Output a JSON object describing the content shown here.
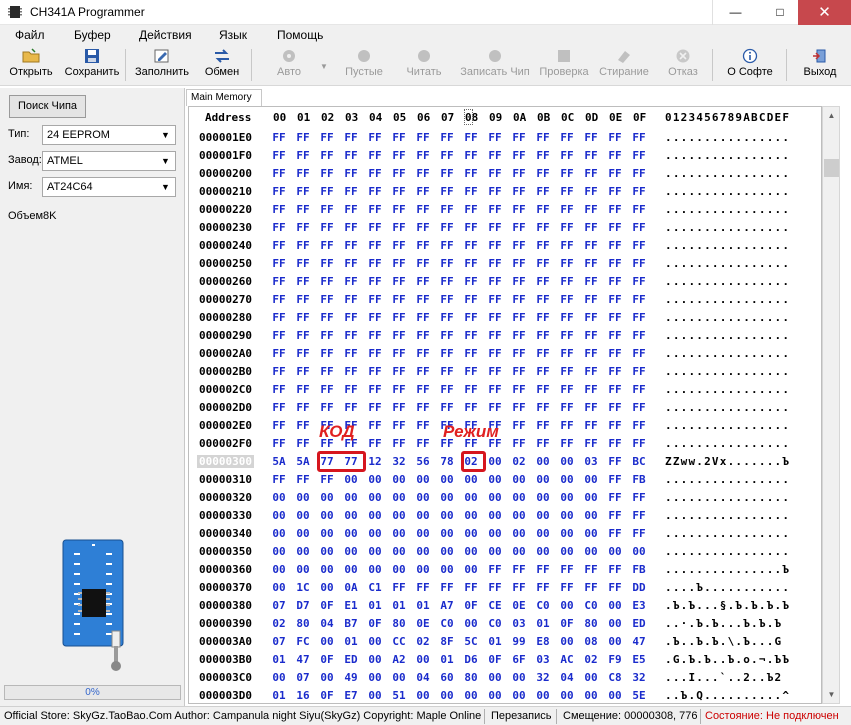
{
  "window": {
    "title": "CH341A Programmer",
    "minimize": "—",
    "maximize": "□",
    "close": "✕"
  },
  "menu": [
    "Файл",
    "Буфер",
    "Действия",
    "Язык",
    "Помощь"
  ],
  "toolbar": {
    "open": "Открыть",
    "save": "Сохранить",
    "fill": "Заполнить",
    "swap": "Обмен",
    "auto": "Авто",
    "blank": "Пустые",
    "read": "Читать",
    "write": "Записать Чип",
    "verify": "Проверка",
    "erase": "Стирание",
    "cancel": "Отказ",
    "about": "О Софте",
    "exit": "Выход"
  },
  "left": {
    "find_chip": "Поиск Чипа",
    "type_label": "Тип:",
    "type_value": "24 EEPROM",
    "vendor_label": "Завод:",
    "vendor_value": "ATMEL",
    "name_label": "Имя:",
    "name_value": "AT24C64",
    "size_label": "Объем8K",
    "progress": "0%"
  },
  "tab": "Main Memory",
  "hex": {
    "address_header": "Address",
    "columns": [
      "00",
      "01",
      "02",
      "03",
      "04",
      "05",
      "06",
      "07",
      "08",
      "09",
      "0A",
      "0B",
      "0C",
      "0D",
      "0E",
      "0F"
    ],
    "ascii_header": "0123456789ABCDEF",
    "rows": [
      {
        "addr": "000001E0",
        "bytes": [
          "FF",
          "FF",
          "FF",
          "FF",
          "FF",
          "FF",
          "FF",
          "FF",
          "FF",
          "FF",
          "FF",
          "FF",
          "FF",
          "FF",
          "FF",
          "FF"
        ],
        "ascii": "................"
      },
      {
        "addr": "000001F0",
        "bytes": [
          "FF",
          "FF",
          "FF",
          "FF",
          "FF",
          "FF",
          "FF",
          "FF",
          "FF",
          "FF",
          "FF",
          "FF",
          "FF",
          "FF",
          "FF",
          "FF"
        ],
        "ascii": "................"
      },
      {
        "addr": "00000200",
        "bytes": [
          "FF",
          "FF",
          "FF",
          "FF",
          "FF",
          "FF",
          "FF",
          "FF",
          "FF",
          "FF",
          "FF",
          "FF",
          "FF",
          "FF",
          "FF",
          "FF"
        ],
        "ascii": "................"
      },
      {
        "addr": "00000210",
        "bytes": [
          "FF",
          "FF",
          "FF",
          "FF",
          "FF",
          "FF",
          "FF",
          "FF",
          "FF",
          "FF",
          "FF",
          "FF",
          "FF",
          "FF",
          "FF",
          "FF"
        ],
        "ascii": "................"
      },
      {
        "addr": "00000220",
        "bytes": [
          "FF",
          "FF",
          "FF",
          "FF",
          "FF",
          "FF",
          "FF",
          "FF",
          "FF",
          "FF",
          "FF",
          "FF",
          "FF",
          "FF",
          "FF",
          "FF"
        ],
        "ascii": "................"
      },
      {
        "addr": "00000230",
        "bytes": [
          "FF",
          "FF",
          "FF",
          "FF",
          "FF",
          "FF",
          "FF",
          "FF",
          "FF",
          "FF",
          "FF",
          "FF",
          "FF",
          "FF",
          "FF",
          "FF"
        ],
        "ascii": "................"
      },
      {
        "addr": "00000240",
        "bytes": [
          "FF",
          "FF",
          "FF",
          "FF",
          "FF",
          "FF",
          "FF",
          "FF",
          "FF",
          "FF",
          "FF",
          "FF",
          "FF",
          "FF",
          "FF",
          "FF"
        ],
        "ascii": "................"
      },
      {
        "addr": "00000250",
        "bytes": [
          "FF",
          "FF",
          "FF",
          "FF",
          "FF",
          "FF",
          "FF",
          "FF",
          "FF",
          "FF",
          "FF",
          "FF",
          "FF",
          "FF",
          "FF",
          "FF"
        ],
        "ascii": "................"
      },
      {
        "addr": "00000260",
        "bytes": [
          "FF",
          "FF",
          "FF",
          "FF",
          "FF",
          "FF",
          "FF",
          "FF",
          "FF",
          "FF",
          "FF",
          "FF",
          "FF",
          "FF",
          "FF",
          "FF"
        ],
        "ascii": "................"
      },
      {
        "addr": "00000270",
        "bytes": [
          "FF",
          "FF",
          "FF",
          "FF",
          "FF",
          "FF",
          "FF",
          "FF",
          "FF",
          "FF",
          "FF",
          "FF",
          "FF",
          "FF",
          "FF",
          "FF"
        ],
        "ascii": "................"
      },
      {
        "addr": "00000280",
        "bytes": [
          "FF",
          "FF",
          "FF",
          "FF",
          "FF",
          "FF",
          "FF",
          "FF",
          "FF",
          "FF",
          "FF",
          "FF",
          "FF",
          "FF",
          "FF",
          "FF"
        ],
        "ascii": "................"
      },
      {
        "addr": "00000290",
        "bytes": [
          "FF",
          "FF",
          "FF",
          "FF",
          "FF",
          "FF",
          "FF",
          "FF",
          "FF",
          "FF",
          "FF",
          "FF",
          "FF",
          "FF",
          "FF",
          "FF"
        ],
        "ascii": "................"
      },
      {
        "addr": "000002A0",
        "bytes": [
          "FF",
          "FF",
          "FF",
          "FF",
          "FF",
          "FF",
          "FF",
          "FF",
          "FF",
          "FF",
          "FF",
          "FF",
          "FF",
          "FF",
          "FF",
          "FF"
        ],
        "ascii": "................"
      },
      {
        "addr": "000002B0",
        "bytes": [
          "FF",
          "FF",
          "FF",
          "FF",
          "FF",
          "FF",
          "FF",
          "FF",
          "FF",
          "FF",
          "FF",
          "FF",
          "FF",
          "FF",
          "FF",
          "FF"
        ],
        "ascii": "................"
      },
      {
        "addr": "000002C0",
        "bytes": [
          "FF",
          "FF",
          "FF",
          "FF",
          "FF",
          "FF",
          "FF",
          "FF",
          "FF",
          "FF",
          "FF",
          "FF",
          "FF",
          "FF",
          "FF",
          "FF"
        ],
        "ascii": "................"
      },
      {
        "addr": "000002D0",
        "bytes": [
          "FF",
          "FF",
          "FF",
          "FF",
          "FF",
          "FF",
          "FF",
          "FF",
          "FF",
          "FF",
          "FF",
          "FF",
          "FF",
          "FF",
          "FF",
          "FF"
        ],
        "ascii": "................"
      },
      {
        "addr": "000002E0",
        "bytes": [
          "FF",
          "FF",
          "FF",
          "FF",
          "FF",
          "FF",
          "FF",
          "FF",
          "FF",
          "FF",
          "FF",
          "FF",
          "FF",
          "FF",
          "FF",
          "FF"
        ],
        "ascii": "................"
      },
      {
        "addr": "000002F0",
        "bytes": [
          "FF",
          "FF",
          "FF",
          "FF",
          "FF",
          "FF",
          "FF",
          "FF",
          "FF",
          "FF",
          "FF",
          "FF",
          "FF",
          "FF",
          "FF",
          "FF"
        ],
        "ascii": "................"
      },
      {
        "addr": "00000300",
        "bytes": [
          "5A",
          "5A",
          "77",
          "77",
          "12",
          "32",
          "56",
          "78",
          "02",
          "00",
          "02",
          "00",
          "00",
          "03",
          "FF",
          "BC"
        ],
        "ascii": "ZZww.2Vx.......Ъ",
        "selected": true
      },
      {
        "addr": "00000310",
        "bytes": [
          "FF",
          "FF",
          "FF",
          "00",
          "00",
          "00",
          "00",
          "00",
          "00",
          "00",
          "00",
          "00",
          "00",
          "00",
          "FF",
          "FB"
        ],
        "ascii": "................"
      },
      {
        "addr": "00000320",
        "bytes": [
          "00",
          "00",
          "00",
          "00",
          "00",
          "00",
          "00",
          "00",
          "00",
          "00",
          "00",
          "00",
          "00",
          "00",
          "FF",
          "FF"
        ],
        "ascii": "................"
      },
      {
        "addr": "00000330",
        "bytes": [
          "00",
          "00",
          "00",
          "00",
          "00",
          "00",
          "00",
          "00",
          "00",
          "00",
          "00",
          "00",
          "00",
          "00",
          "FF",
          "FF"
        ],
        "ascii": "................"
      },
      {
        "addr": "00000340",
        "bytes": [
          "00",
          "00",
          "00",
          "00",
          "00",
          "00",
          "00",
          "00",
          "00",
          "00",
          "00",
          "00",
          "00",
          "00",
          "FF",
          "FF"
        ],
        "ascii": "................"
      },
      {
        "addr": "00000350",
        "bytes": [
          "00",
          "00",
          "00",
          "00",
          "00",
          "00",
          "00",
          "00",
          "00",
          "00",
          "00",
          "00",
          "00",
          "00",
          "00",
          "00"
        ],
        "ascii": "................"
      },
      {
        "addr": "00000360",
        "bytes": [
          "00",
          "00",
          "00",
          "00",
          "00",
          "00",
          "00",
          "00",
          "00",
          "FF",
          "FF",
          "FF",
          "FF",
          "FF",
          "FF",
          "FB"
        ],
        "ascii": "...............Ъ"
      },
      {
        "addr": "00000370",
        "bytes": [
          "00",
          "1C",
          "00",
          "0A",
          "C1",
          "FF",
          "FF",
          "FF",
          "FF",
          "FF",
          "FF",
          "FF",
          "FF",
          "FF",
          "FF",
          "DD"
        ],
        "ascii": "....Ъ..........."
      },
      {
        "addr": "00000380",
        "bytes": [
          "07",
          "D7",
          "0F",
          "E1",
          "01",
          "01",
          "01",
          "A7",
          "0F",
          "CE",
          "0E",
          "C0",
          "00",
          "C0",
          "00",
          "E3"
        ],
        "ascii": ".Ъ.Ъ...§.Ъ.Ъ.Ъ.Ъ"
      },
      {
        "addr": "00000390",
        "bytes": [
          "02",
          "80",
          "04",
          "B7",
          "0F",
          "80",
          "0E",
          "C0",
          "00",
          "C0",
          "03",
          "01",
          "0F",
          "80",
          "00",
          "ED"
        ],
        "ascii": "..·.Ъ.Ъ...Ъ.Ъ.Ъ"
      },
      {
        "addr": "000003A0",
        "bytes": [
          "07",
          "FC",
          "00",
          "01",
          "00",
          "CC",
          "02",
          "8F",
          "5C",
          "01",
          "99",
          "E8",
          "00",
          "08",
          "00",
          "47"
        ],
        "ascii": ".Ъ..Ъ.Ъ.\\.Ъ...G"
      },
      {
        "addr": "000003B0",
        "bytes": [
          "01",
          "47",
          "0F",
          "ED",
          "00",
          "A2",
          "00",
          "01",
          "D6",
          "0F",
          "6F",
          "03",
          "AC",
          "02",
          "F9",
          "E5"
        ],
        "ascii": ".G.Ъ.Ъ..Ъ.o.¬.ЪЪ"
      },
      {
        "addr": "000003C0",
        "bytes": [
          "00",
          "07",
          "00",
          "49",
          "00",
          "00",
          "04",
          "60",
          "80",
          "00",
          "00",
          "32",
          "04",
          "00",
          "C8",
          "32"
        ],
        "ascii": "...I...`..2..Ъ2"
      },
      {
        "addr": "000003D0",
        "bytes": [
          "01",
          "16",
          "0F",
          "E7",
          "00",
          "51",
          "00",
          "00",
          "00",
          "00",
          "00",
          "00",
          "00",
          "00",
          "00",
          "5E"
        ],
        "ascii": "..Ъ.Q..........^"
      }
    ]
  },
  "annotations": {
    "code_label": "КОД",
    "mode_label": "Режим"
  },
  "status": {
    "store": "Official Store: SkyGz.TaoBao.Com Author: Campanula night Siyu(SkyGz) Copyright: Maple Online",
    "mode": "Перезапись",
    "offset": "Смещение: 00000308, 776",
    "state": "Состояние: Не подключен",
    "state_color": "#cc0000"
  },
  "colors": {
    "hex_bytes": "#1a2bcc",
    "highlight": "#d6161e",
    "close_button": "#c7484d"
  }
}
